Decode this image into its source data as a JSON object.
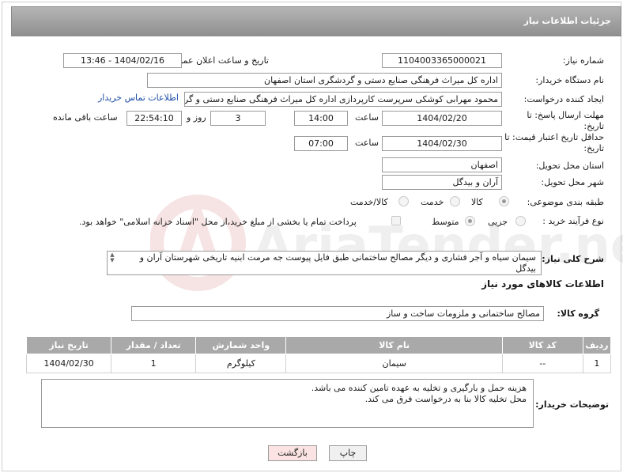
{
  "header": {
    "title": "جزئیات اطلاعات نیاز"
  },
  "labels": {
    "need_number": "شماره نیاز:",
    "announce_datetime": "تاریخ و ساعت اعلان عمومی:",
    "buyer_org": "نام دستگاه خریدار:",
    "requester": "ایجاد کننده درخواست:",
    "reply_deadline": "مهلت ارسال پاسخ: تا تاریخ:",
    "price_validity": "حداقل تاریخ اعتبار قیمت: تا تاریخ:",
    "hour": "ساعت",
    "day_and": "روز و",
    "remaining": "ساعت باقی مانده",
    "province": "استان محل تحویل:",
    "city": "شهر محل تحویل:",
    "category": "طبقه بندی موضوعی:",
    "process_type": "نوع فرآیند خرید :",
    "summary": "شرح کلی نیاز:",
    "goods_info": "اطلاعات کالاهای مورد نیاز",
    "goods_group": "گروه کالا:",
    "buyer_notes": "توضیحات خریدار:"
  },
  "fields": {
    "need_number": "1104003365000021",
    "announce_datetime": "1404/02/16 - 13:46",
    "buyer_org": "اداره کل میراث فرهنگی  صنایع دستی و گردشگری استان اصفهان",
    "requester": "محمود مهرابی کوشکی سرپرست کارپردازی اداره کل میراث فرهنگی  صنایع دستی و گردشگری استان اصفهان",
    "contact_link": "اطلاعات تماس خریدار",
    "reply_date": "1404/02/20",
    "reply_time": "14:00",
    "reply_days": "3",
    "reply_remaining": "22:54:10",
    "validity_date": "1404/02/30",
    "validity_time": "07:00",
    "province": "اصفهان",
    "city": "آران و بیدگل",
    "summary": "سیمان سیاه و آجر فشاری و دیگر مصالح ساختمانی طبق فایل پیوست جه مرمت ابنیه تاریخی شهرستان آران و بیدگل",
    "goods_group": "مصالح ساختمانی و ملزومات ساخت و ساز",
    "buyer_notes_line1": "هزینه حمل و بارگیری و تخلیه به عهده تامین کننده می باشد.",
    "buyer_notes_line2": "محل تخلیه کالا بنا به درخواست فرق می کند."
  },
  "category_options": [
    "کالا",
    "خدمت",
    "کالا/خدمت"
  ],
  "process_options": [
    "جزیی",
    "متوسط"
  ],
  "payment_note": "پرداخت تمام یا بخشی از مبلغ خرید،از محل \"اسناد خزانه اسلامی\" خواهد بود.",
  "table": {
    "headers": [
      "ردیف",
      "کد کالا",
      "نام کالا",
      "واحد شمارش",
      "تعداد / مقدار",
      "تاریخ نیاز"
    ],
    "rows": [
      [
        "1",
        "--",
        "سیمان",
        "کیلوگرم",
        "1",
        "1404/02/30"
      ]
    ]
  },
  "buttons": {
    "print": "چاپ",
    "back": "بازگشت"
  },
  "watermark": "AriaTender.neT"
}
